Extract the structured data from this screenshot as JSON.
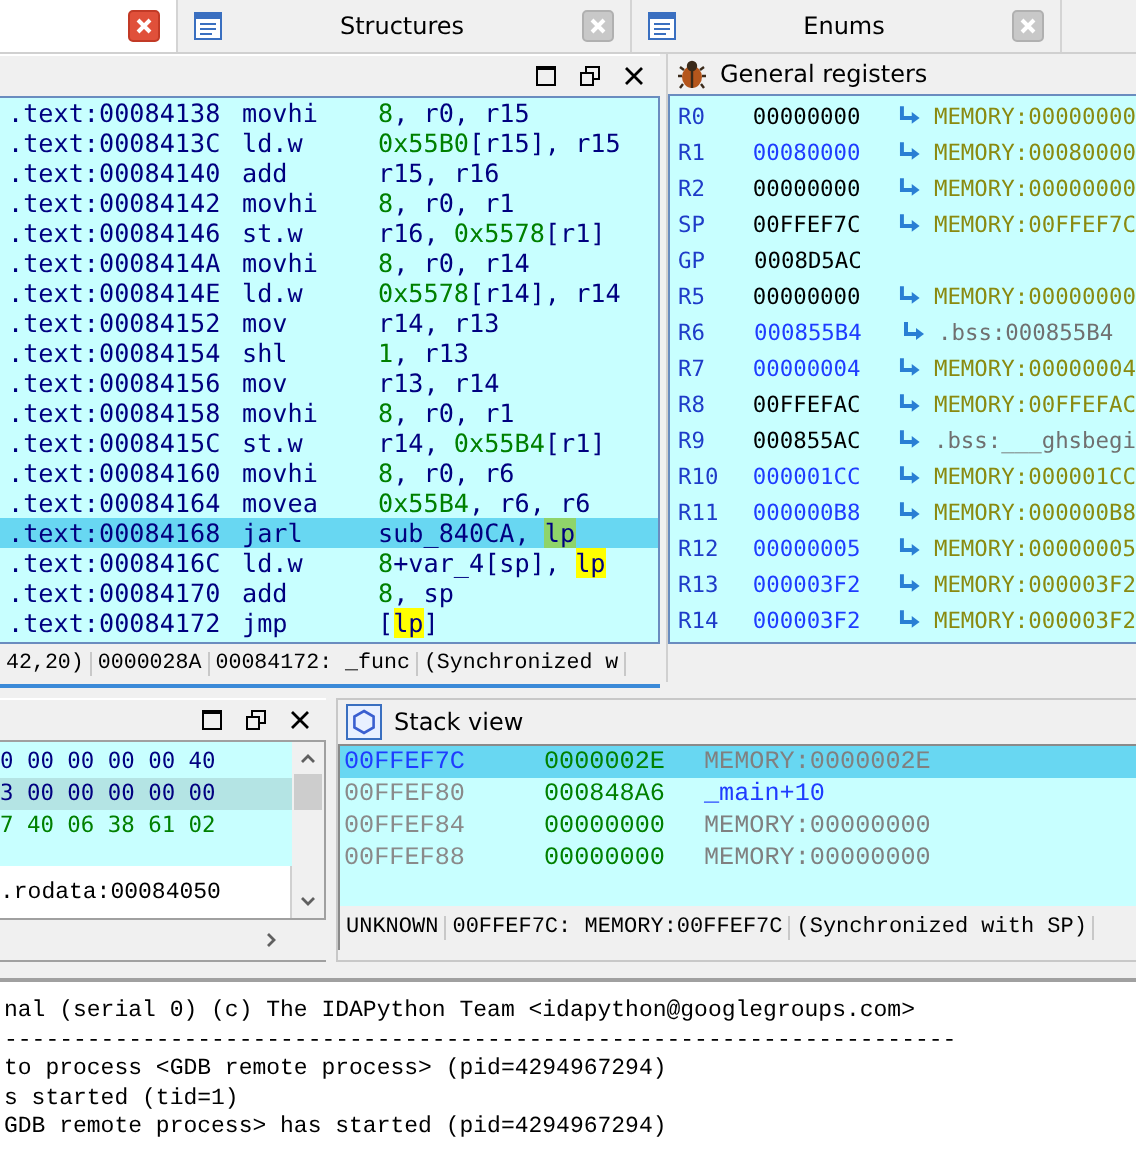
{
  "tabs": [
    {
      "selected": true
    },
    {
      "label": "Structures",
      "selected": false
    },
    {
      "label": "Enums",
      "selected": false
    }
  ],
  "disassembly": {
    "lines": [
      {
        "address": ".text:00084138",
        "mnemonic": "movhi",
        "operands": [
          {
            "text": "8",
            "kind": "num"
          },
          {
            "text": ", r0, r15",
            "kind": "reg"
          }
        ],
        "selected": false
      },
      {
        "address": ".text:0008413C",
        "mnemonic": "ld.w",
        "operands": [
          {
            "text": "0x55B0",
            "kind": "num"
          },
          {
            "text": "[r15], r15",
            "kind": "reg"
          }
        ],
        "selected": false
      },
      {
        "address": ".text:00084140",
        "mnemonic": "add",
        "operands": [
          {
            "text": "r15, r16",
            "kind": "reg"
          }
        ],
        "selected": false
      },
      {
        "address": ".text:00084142",
        "mnemonic": "movhi",
        "operands": [
          {
            "text": "8",
            "kind": "num"
          },
          {
            "text": ", r0, r1",
            "kind": "reg"
          }
        ],
        "selected": false
      },
      {
        "address": ".text:00084146",
        "mnemonic": "st.w",
        "operands": [
          {
            "text": "r16, ",
            "kind": "reg"
          },
          {
            "text": "0x5578",
            "kind": "num"
          },
          {
            "text": "[r1]",
            "kind": "reg"
          }
        ],
        "selected": false
      },
      {
        "address": ".text:0008414A",
        "mnemonic": "movhi",
        "operands": [
          {
            "text": "8",
            "kind": "num"
          },
          {
            "text": ", r0, r14",
            "kind": "reg"
          }
        ],
        "selected": false
      },
      {
        "address": ".text:0008414E",
        "mnemonic": "ld.w",
        "operands": [
          {
            "text": "0x5578",
            "kind": "num"
          },
          {
            "text": "[r14], r14",
            "kind": "reg"
          }
        ],
        "selected": false
      },
      {
        "address": ".text:00084152",
        "mnemonic": "mov",
        "operands": [
          {
            "text": "r14, r13",
            "kind": "reg"
          }
        ],
        "selected": false
      },
      {
        "address": ".text:00084154",
        "mnemonic": "shl",
        "operands": [
          {
            "text": "1",
            "kind": "num"
          },
          {
            "text": ", r13",
            "kind": "reg"
          }
        ],
        "selected": false
      },
      {
        "address": ".text:00084156",
        "mnemonic": "mov",
        "operands": [
          {
            "text": "r13, r14",
            "kind": "reg"
          }
        ],
        "selected": false
      },
      {
        "address": ".text:00084158",
        "mnemonic": "movhi",
        "operands": [
          {
            "text": "8",
            "kind": "num"
          },
          {
            "text": ", r0, r1",
            "kind": "reg"
          }
        ],
        "selected": false
      },
      {
        "address": ".text:0008415C",
        "mnemonic": "st.w",
        "operands": [
          {
            "text": "r14, ",
            "kind": "reg"
          },
          {
            "text": "0x55B4",
            "kind": "num"
          },
          {
            "text": "[r1]",
            "kind": "reg"
          }
        ],
        "selected": false
      },
      {
        "address": ".text:00084160",
        "mnemonic": "movhi",
        "operands": [
          {
            "text": "8",
            "kind": "num"
          },
          {
            "text": ", r0, r6",
            "kind": "reg"
          }
        ],
        "selected": false
      },
      {
        "address": ".text:00084164",
        "mnemonic": "movea",
        "operands": [
          {
            "text": "0x55B4",
            "kind": "num"
          },
          {
            "text": ", r6, r6",
            "kind": "reg"
          }
        ],
        "selected": false
      },
      {
        "address": ".text:00084168",
        "mnemonic": "jarl",
        "operands": [
          {
            "text": "sub_840CA, ",
            "kind": "reg"
          },
          {
            "text": "lp",
            "kind": "current"
          }
        ],
        "selected": true
      },
      {
        "address": ".text:0008416C",
        "mnemonic": "ld.w",
        "operands": [
          {
            "text": "8",
            "kind": "num"
          },
          {
            "text": "+var_4[sp], ",
            "kind": "reg"
          },
          {
            "text": "lp",
            "kind": "highlight"
          }
        ],
        "selected": false
      },
      {
        "address": ".text:00084170",
        "mnemonic": "add",
        "operands": [
          {
            "text": "8",
            "kind": "num"
          },
          {
            "text": ", sp",
            "kind": "reg"
          }
        ],
        "selected": false
      },
      {
        "address": ".text:00084172",
        "mnemonic": "jmp",
        "operands": [
          {
            "text": "[",
            "kind": "reg"
          },
          {
            "text": "lp",
            "kind": "highlight"
          },
          {
            "text": "]",
            "kind": "reg"
          }
        ],
        "selected": false
      }
    ],
    "status": [
      "42,20)",
      "0000028A",
      "00084172: _func",
      "(Synchronized w"
    ]
  },
  "registers": {
    "title": "General registers",
    "rows": [
      {
        "name": "R0",
        "value": "00000000",
        "changed": false,
        "target": "MEMORY:00000000",
        "kind": "memory"
      },
      {
        "name": "R1",
        "value": "00080000",
        "changed": true,
        "target": "MEMORY:00080000",
        "kind": "memory"
      },
      {
        "name": "R2",
        "value": "00000000",
        "changed": false,
        "target": "MEMORY:00000000",
        "kind": "memory"
      },
      {
        "name": "SP",
        "value": "00FFEF7C",
        "changed": false,
        "target": "MEMORY:00FFEF7C",
        "kind": "memory"
      },
      {
        "name": "GP",
        "value": "0008D5AC",
        "changed": false
      },
      {
        "name": "R5",
        "value": "00000000",
        "changed": false,
        "target": "MEMORY:00000000",
        "kind": "memory"
      },
      {
        "name": "R6",
        "value": "000855B4",
        "changed": true,
        "target": ".bss:000855B4",
        "kind": "segment"
      },
      {
        "name": "R7",
        "value": "00000004",
        "changed": true,
        "target": "MEMORY:00000004",
        "kind": "memory"
      },
      {
        "name": "R8",
        "value": "00FFEFAC",
        "changed": false,
        "target": "MEMORY:00FFEFAC",
        "kind": "memory"
      },
      {
        "name": "R9",
        "value": "000855AC",
        "changed": false,
        "target": ".bss:___ghsbegi",
        "kind": "segment"
      },
      {
        "name": "R10",
        "value": "000001CC",
        "changed": true,
        "target": "MEMORY:000001CC",
        "kind": "memory"
      },
      {
        "name": "R11",
        "value": "000000B8",
        "changed": true,
        "target": "MEMORY:000000B8",
        "kind": "memory"
      },
      {
        "name": "R12",
        "value": "00000005",
        "changed": true,
        "target": "MEMORY:00000005",
        "kind": "memory"
      },
      {
        "name": "R13",
        "value": "000003F2",
        "changed": true,
        "target": "MEMORY:000003F2",
        "kind": "memory"
      },
      {
        "name": "R14",
        "value": "000003F2",
        "changed": true,
        "target": "MEMORY:000003F2",
        "kind": "memory"
      }
    ]
  },
  "hex_view": {
    "rows": [
      {
        "bytes": "0 00 00 00 00 40",
        "kind": "data",
        "selected": false
      },
      {
        "bytes": "3 00 00 00 00 00",
        "kind": "data",
        "selected": true
      },
      {
        "bytes": "7 40 06 38 61 02",
        "kind": "code",
        "selected": false
      }
    ],
    "status": ".rodata:00084050"
  },
  "stack_view": {
    "title": "Stack view",
    "rows": [
      {
        "address": "00FFEF7C",
        "value": "0000002E",
        "target": "MEMORY:0000002E",
        "kind": "memory",
        "selected": true
      },
      {
        "address": "00FFEF80",
        "value": "000848A6",
        "target": "_main+10",
        "kind": "name",
        "selected": false
      },
      {
        "address": "00FFEF84",
        "value": "00000000",
        "target": "MEMORY:00000000",
        "kind": "memory",
        "selected": false
      },
      {
        "address": "00FFEF88",
        "value": "00000000",
        "target": "MEMORY:00000000",
        "kind": "memory",
        "selected": false
      }
    ],
    "status": [
      "UNKNOWN",
      "00FFEF7C: MEMORY:00FFEF7C",
      "(Synchronized with SP)"
    ]
  },
  "output": {
    "lines": [
      "nal (serial 0) (c) The IDAPython Team <idapython@googlegroups.com>",
      "---------------------------------------------------------------------",
      "to process <GDB remote process> (pid=4294967294)",
      "s started (tid=1)",
      "GDB remote process> has started (pid=4294967294)"
    ]
  }
}
